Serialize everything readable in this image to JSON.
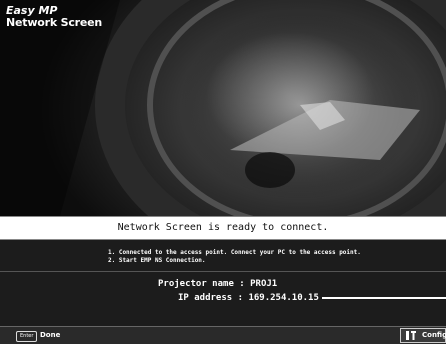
{
  "logo": {
    "line1": "Easy MP",
    "line2": "Network Screen"
  },
  "status_message": "Network Screen is ready to connect.",
  "instructions": [
    "1. Connected to the access point. Connect your PC to the access point.",
    "2. Start EMP NS Connection."
  ],
  "projector": {
    "name_label": "Projector name :",
    "name": "PROJ1",
    "ip_label": "IP address :",
    "ip": "169.254.10.15"
  },
  "footer": {
    "enter_key": "Enter",
    "done_label": "Done",
    "config_label": "Config",
    "config_icon": "config-icon"
  }
}
